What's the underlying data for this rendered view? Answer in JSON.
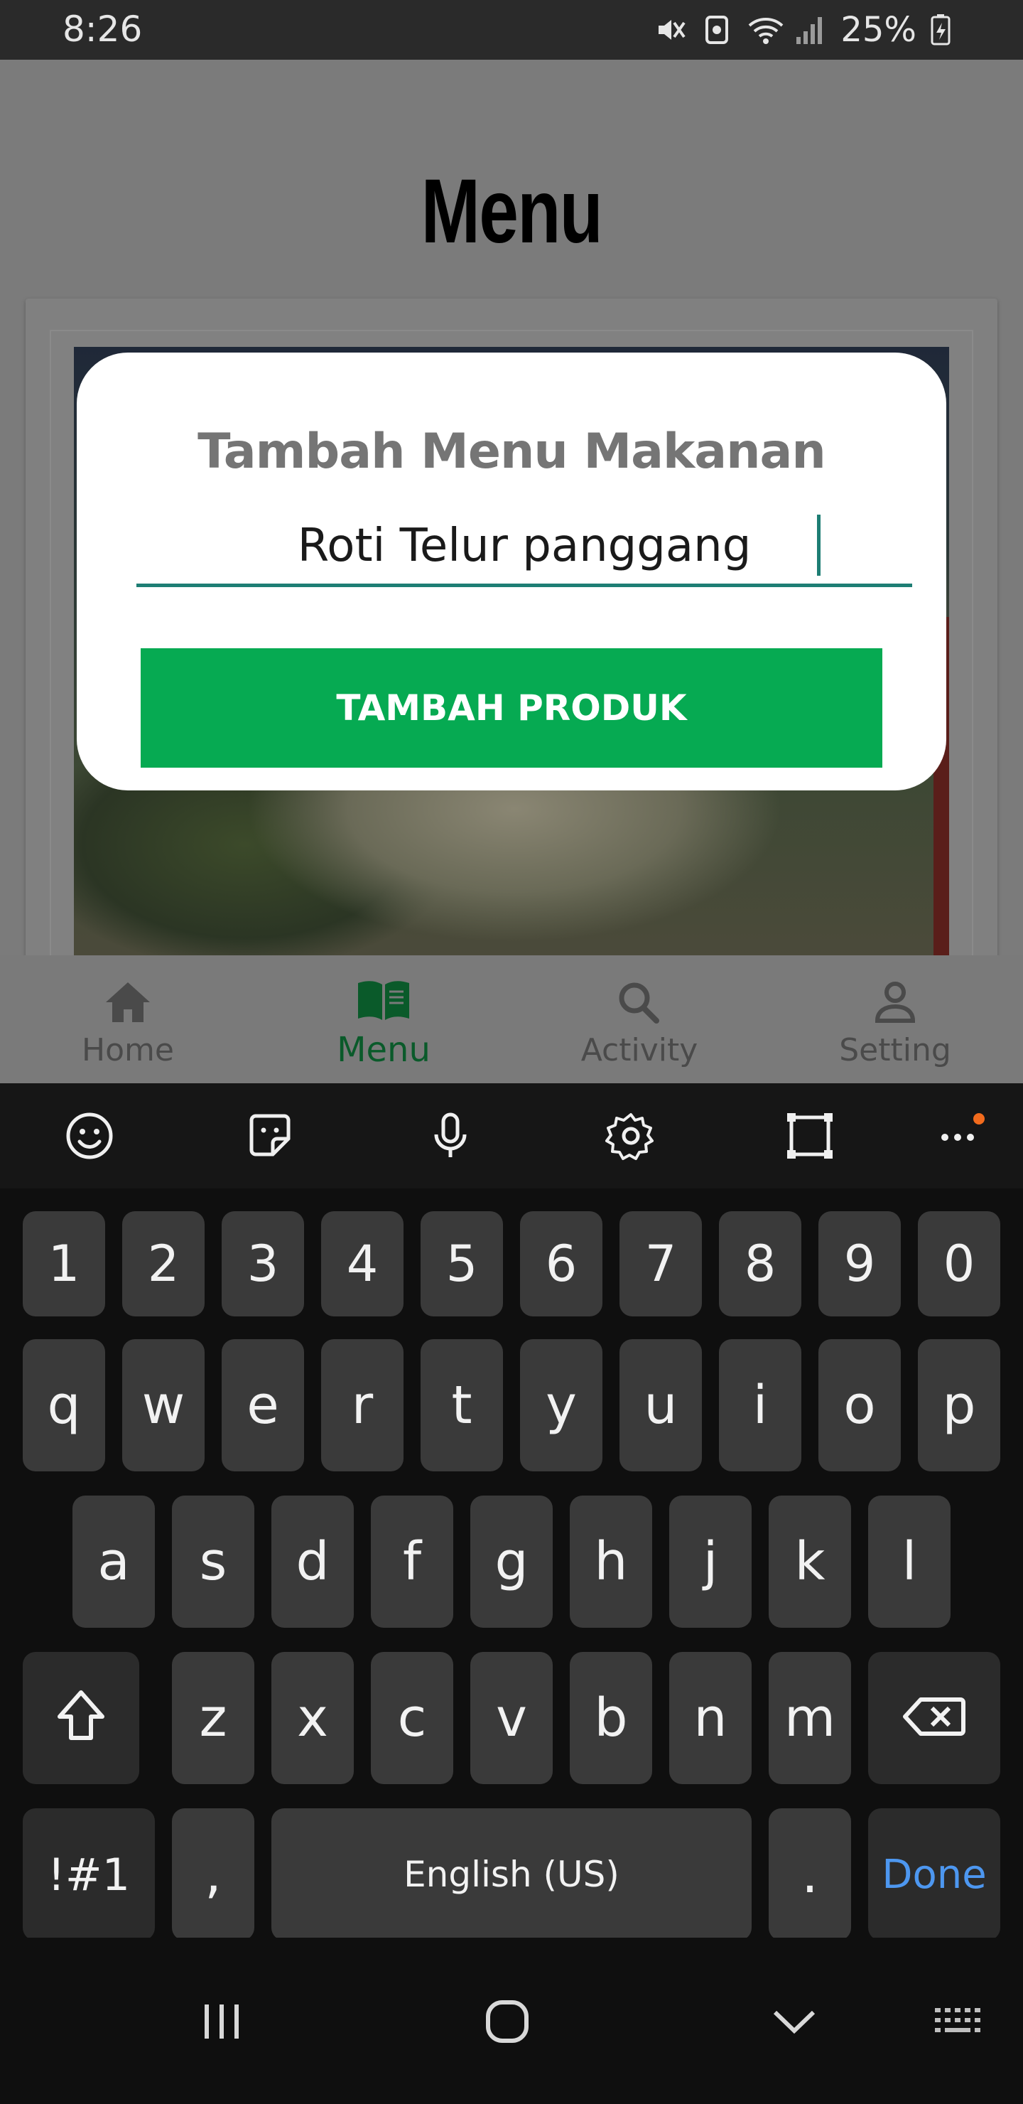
{
  "status_bar": {
    "time": "8:26",
    "battery": "25%",
    "icons": [
      "mute-vibrate-icon",
      "nfc-icon",
      "wifi-icon",
      "signal-icon",
      "battery-charging-icon"
    ]
  },
  "app": {
    "page_title": "Menu"
  },
  "dialog": {
    "title": "Tambah Menu Makanan",
    "input_value": "Roti Telur panggang",
    "button_label": "TAMBAH PRODUK",
    "accent_color": "#1e7e74",
    "button_color": "#06aa52"
  },
  "bottom_nav": {
    "items": [
      {
        "label": "Home",
        "icon": "home-icon"
      },
      {
        "label": "Menu",
        "icon": "book-icon",
        "active": true
      },
      {
        "label": "Activity",
        "icon": "search-icon"
      },
      {
        "label": "Setting",
        "icon": "person-icon"
      }
    ],
    "active_color": "#0a5a2a"
  },
  "keyboard": {
    "toolbar": [
      "emoji-icon",
      "sticker-icon",
      "mic-icon",
      "settings-icon",
      "resize-icon",
      "more-icon"
    ],
    "row_numbers": [
      "1",
      "2",
      "3",
      "4",
      "5",
      "6",
      "7",
      "8",
      "9",
      "0"
    ],
    "row_1": [
      "q",
      "w",
      "e",
      "r",
      "t",
      "y",
      "u",
      "i",
      "o",
      "p"
    ],
    "row_2": [
      "a",
      "s",
      "d",
      "f",
      "g",
      "h",
      "j",
      "k",
      "l"
    ],
    "row_3": [
      "z",
      "x",
      "c",
      "v",
      "b",
      "n",
      "m"
    ],
    "symbols_label": "!#1",
    "comma_label": ",",
    "space_label": "English (US)",
    "period_label": ".",
    "done_label": "Done",
    "done_color": "#4d97f0"
  }
}
